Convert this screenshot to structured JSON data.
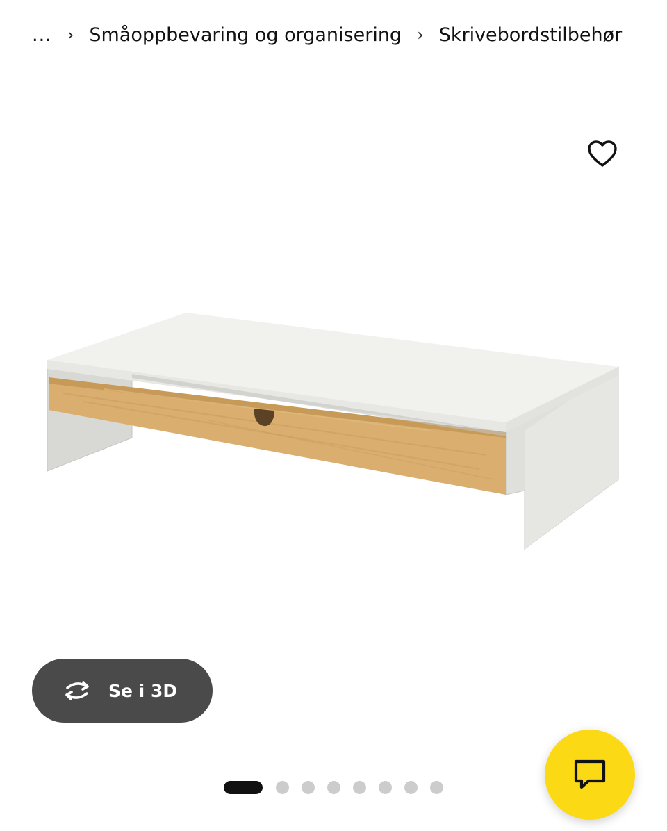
{
  "breadcrumb": {
    "ellipsis": "...",
    "items": [
      "Småoppbevaring og organisering",
      "Skrivebordstilbehør"
    ]
  },
  "gallery": {
    "view3d_label": "Se i 3D",
    "slide_count": 8,
    "active_slide": 1
  },
  "colors": {
    "chat_button": "#fbd914",
    "view3d_button": "#4a4a4a",
    "dot_active": "#111111",
    "dot_inactive": "#cccccc"
  },
  "icons": {
    "favorite": "heart-icon",
    "view3d": "rotate-icon",
    "chat": "chat-bubble-icon"
  }
}
